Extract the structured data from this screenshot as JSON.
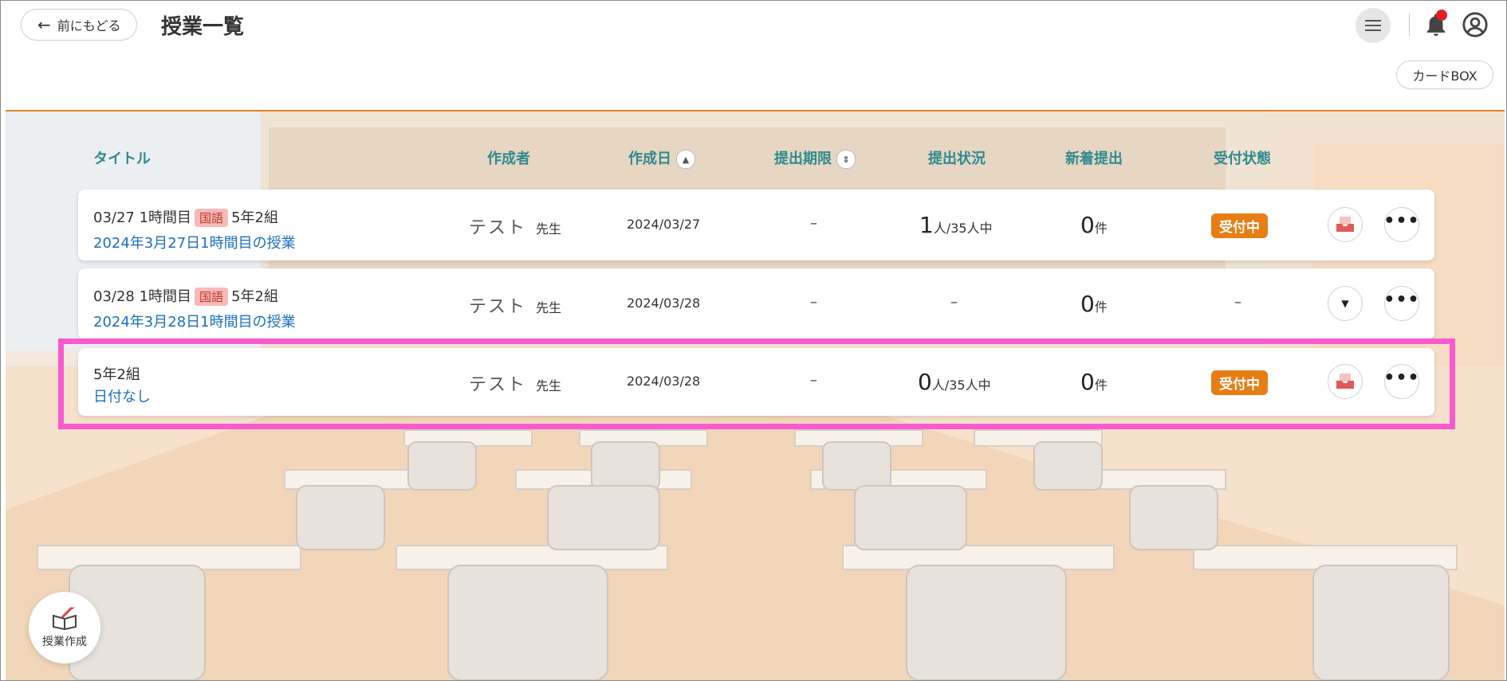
{
  "header": {
    "back_label": "前にもどる",
    "title": "授業一覧",
    "cardbox_label": "カードBOX"
  },
  "columns": {
    "title": "タイトル",
    "author": "作成者",
    "created": "作成日",
    "deadline": "提出期限",
    "submission_status": "提出状況",
    "new_submissions": "新着提出",
    "reception_status": "受付状態"
  },
  "rows": [
    {
      "line1": "03/27 1時間目",
      "subject": "国語",
      "class": "5年2組",
      "link": "2024年3月27日1時間目の授業",
      "author": "テスト",
      "author_suffix": "先生",
      "date": "2024/03/27",
      "deadline": "–",
      "submitted_count": "1",
      "submitted_of": "人/35人中",
      "new_count": "0",
      "new_unit": "件",
      "reception": "受付中"
    },
    {
      "line1": "03/28 1時間目",
      "subject": "国語",
      "class": "5年2組",
      "link": "2024年3月28日1時間目の授業",
      "author": "テスト",
      "author_suffix": "先生",
      "date": "2024/03/28",
      "deadline": "–",
      "submission": "–",
      "new_count": "0",
      "new_unit": "件",
      "reception": "–"
    },
    {
      "class": "5年2組",
      "link": "日付なし",
      "author": "テスト",
      "author_suffix": "先生",
      "date": "2024/03/28",
      "deadline": "–",
      "submitted_count": "0",
      "submitted_of": "人/35人中",
      "new_count": "0",
      "new_unit": "件",
      "reception": "受付中"
    }
  ],
  "create_button_label": "授業作成",
  "icons": {
    "back": "arrow-left-icon",
    "menu": "hamburger-menu-icon",
    "notification": "bell-icon",
    "account": "user-circle-icon",
    "inbox": "inbox-tray-icon",
    "expand": "chevron-down-icon",
    "more": "more-horizontal-icon",
    "create": "book-pencil-icon"
  },
  "colors": {
    "accent_orange": "#e87d14",
    "header_line": "#e8822a",
    "link_blue": "#1a6fc0",
    "column_header": "#2f8a8f",
    "notification_dot": "#e02020",
    "highlight": "#f85ad0",
    "subject_tag_bg": "#f8b9b9"
  }
}
